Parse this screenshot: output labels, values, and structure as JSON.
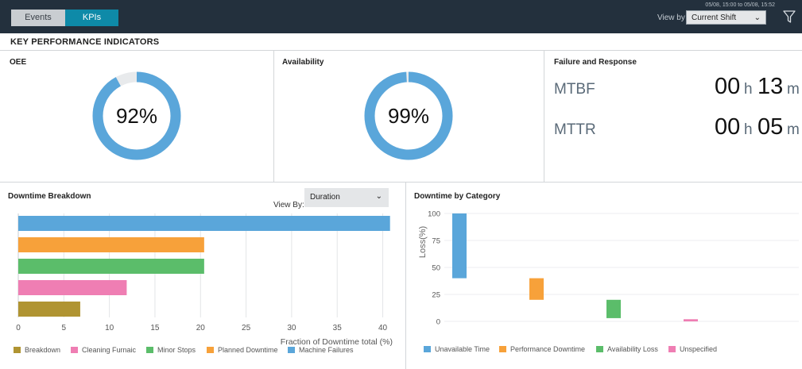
{
  "tabs": [
    {
      "label": "Events",
      "active": false
    },
    {
      "label": "KPIs",
      "active": true
    }
  ],
  "header": {
    "time_range": "05/08, 15:00 to 05/08, 15:52",
    "view_by_label": "View by",
    "view_by_value": "Current Shift",
    "filter_icon": "filter-icon"
  },
  "section_title": "KEY PERFORMANCE INDICATORS",
  "oee": {
    "title": "OEE",
    "value": 92,
    "label": "92%"
  },
  "availability": {
    "title": "Availability",
    "value": 99,
    "label": "99%"
  },
  "failure_response": {
    "title": "Failure and Response",
    "mtbf": {
      "label": "MTBF",
      "hours": "00",
      "hours_unit": "h",
      "minutes": "13",
      "minutes_unit": "m"
    },
    "mttr": {
      "label": "MTTR",
      "hours": "00",
      "hours_unit": "h",
      "minutes": "05",
      "minutes_unit": "m"
    }
  },
  "downtime_breakdown": {
    "title": "Downtime Breakdown",
    "view_by_label": "View By:",
    "view_by_value": "Duration",
    "xlabel": "Fraction of Downtime total (%)"
  },
  "downtime_category": {
    "title": "Downtime by Category",
    "ylabel": "Loss(%)"
  },
  "chart_data": [
    {
      "type": "bar",
      "orientation": "horizontal",
      "categories": [
        "Machine Failures",
        "Planned Downtime",
        "Minor Stops",
        "Cleaning Furnaic",
        "Breakdown"
      ],
      "values": [
        40.8,
        20.4,
        20.4,
        11.9,
        6.8
      ],
      "colors": [
        "#5aa6da",
        "#f7a13a",
        "#5bbd6a",
        "#ef7eb3",
        "#b09432"
      ],
      "xlabel": "Fraction of Downtime total (%)",
      "xlim": [
        0,
        41
      ],
      "xticks": [
        0,
        5,
        10,
        15,
        20,
        25,
        30,
        35,
        40
      ],
      "legend": [
        "Breakdown",
        "Cleaning Furnaic",
        "Minor Stops",
        "Planned Downtime",
        "Machine Failures"
      ],
      "legend_colors": [
        "#b09432",
        "#ef7eb3",
        "#5bbd6a",
        "#f7a13a",
        "#5aa6da"
      ],
      "legend_position": "bottom",
      "grid": true
    },
    {
      "type": "bar",
      "subtype": "waterfall",
      "categories": [
        "Unavailable Time",
        "Performance Downtime",
        "Availability Loss",
        "Unspecified"
      ],
      "ranges": [
        [
          40,
          100
        ],
        [
          20,
          40
        ],
        [
          3,
          20
        ],
        [
          0,
          2
        ]
      ],
      "colors": [
        "#5aa6da",
        "#f7a13a",
        "#5bbd6a",
        "#ef7eb3"
      ],
      "ylabel": "Loss(%)",
      "ylim": [
        0,
        100
      ],
      "yticks": [
        0,
        25,
        50,
        75,
        100
      ],
      "legend_position": "bottom",
      "grid": true
    }
  ]
}
